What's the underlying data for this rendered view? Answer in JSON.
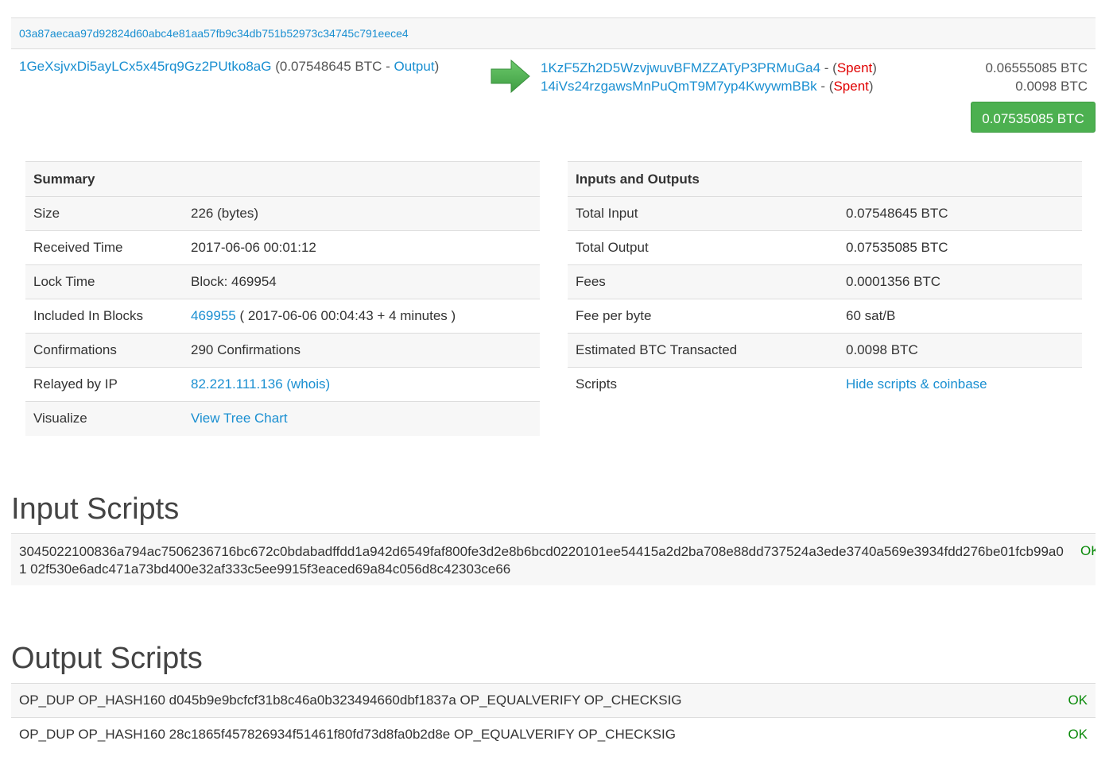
{
  "transaction": {
    "hash": "03a87aecaa97d92824d60abc4e81aa57fb9c34db751b52973c34745c791eece4",
    "input": {
      "address": "1GeXsjvxDi5ayLCx5x45rq9Gz2PUtko8aG",
      "amount": "(0.07548645 BTC - ",
      "output_link": "Output",
      "close_paren": ")"
    },
    "outputs": [
      {
        "address": "1KzF5Zh2D5WzvjwuvBFMZZATyP3PRMuGa4",
        "sep": " - (",
        "status": "Spent",
        "close": ")",
        "amount": "0.06555085 BTC"
      },
      {
        "address": "14iVs24rzgawsMnPuQmT9M7yp4KwywmBBk",
        "sep": " - (",
        "status": "Spent",
        "close": ")",
        "amount": "0.0098 BTC"
      }
    ],
    "total_button": "0.07535085 BTC",
    "arrow_icon": "arrow-right-icon",
    "arrow_color": "#4cb050"
  },
  "summary": {
    "title": "Summary",
    "size_label": "Size",
    "size_value": "226 (bytes)",
    "received_label": "Received Time",
    "received_value": "2017-06-06 00:01:12",
    "lock_label": "Lock Time",
    "lock_value": "Block: 469954",
    "blocks_label": "Included In Blocks",
    "blocks_link": "469955",
    "blocks_rest": " ( 2017-06-06 00:04:43 + 4 minutes )",
    "confirmations_label": "Confirmations",
    "confirmations_value": "290 Confirmations",
    "relayed_label": "Relayed by IP",
    "relayed_value": "82.221.111.136 (whois)",
    "visualize_label": "Visualize",
    "visualize_link": "View Tree Chart"
  },
  "io": {
    "title": "Inputs and Outputs",
    "total_input_label": "Total Input",
    "total_input_value": "0.07548645 BTC",
    "total_output_label": "Total Output",
    "total_output_value": "0.07535085 BTC",
    "fees_label": "Fees",
    "fees_value": "0.0001356 BTC",
    "fee_per_byte_label": "Fee per byte",
    "fee_per_byte_value": "60 sat/B",
    "estimated_label": "Estimated BTC Transacted",
    "estimated_value": "0.0098 BTC",
    "scripts_label": "Scripts",
    "scripts_link": "Hide scripts & coinbase"
  },
  "input_scripts": {
    "title": "Input Scripts",
    "script": "3045022100836a794ac7506236716bc672c0bdabadffdd1a942d6549faf800fe3d2e8b6bcd0220101ee54415a2d2ba708e88dd737524a3ede3740a569e3934fdd276be01fcb99a01 02f530e6adc471a73bd400e32af333c5ee9915f3eaced69a84c056d8c42303ce66",
    "status": "OK"
  },
  "output_scripts": {
    "title": "Output Scripts",
    "rows": [
      {
        "script": "OP_DUP OP_HASH160 d045b9e9bcfcf31b8c46a0b323494660dbf1837a OP_EQUALVERIFY OP_CHECKSIG",
        "status": "OK"
      },
      {
        "script": "OP_DUP OP_HASH160 28c1865f457826934f51461f80fd73d8fa0b2d8e OP_EQUALVERIFY OP_CHECKSIG",
        "status": "OK"
      }
    ]
  }
}
